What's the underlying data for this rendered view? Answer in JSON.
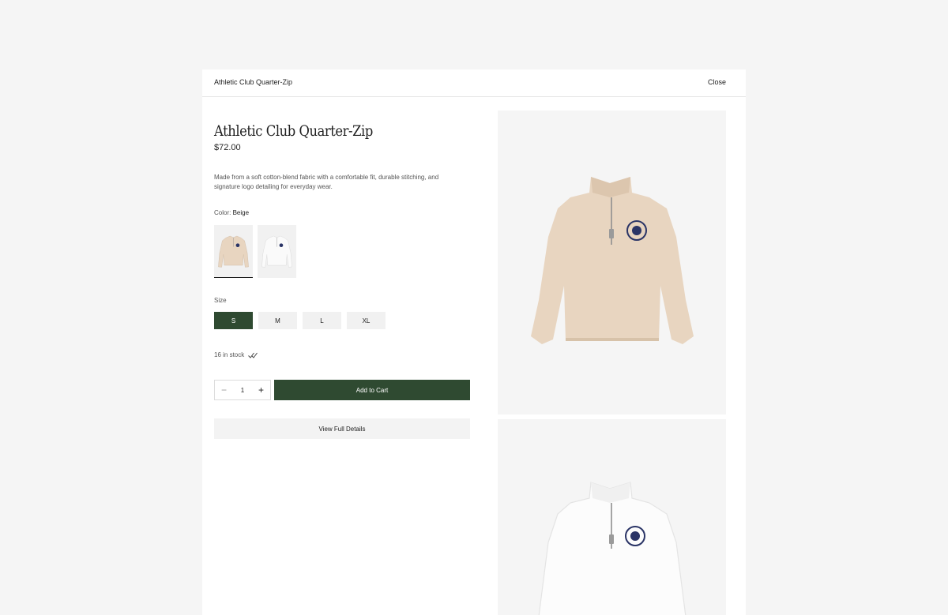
{
  "modal": {
    "header_title": "Athletic Club Quarter-Zip",
    "close_label": "Close"
  },
  "product": {
    "title": "Athletic Club Quarter-Zip",
    "price": "$72.00",
    "description": "Made from a soft cotton-blend fabric with a comfortable fit, durable stitching, and signature logo detailing for everyday wear.",
    "color_label": "Color:",
    "color_value": "Beige",
    "swatches": [
      {
        "name": "Beige",
        "color": "#e8d5c0",
        "selected": true
      },
      {
        "name": "White",
        "color": "#f7f7f7",
        "selected": false
      }
    ],
    "size_label": "Size",
    "sizes": [
      "S",
      "M",
      "L",
      "XL"
    ],
    "selected_size": "S",
    "stock_text": "16 in stock",
    "quantity": "1",
    "add_to_cart_label": "Add to Cart",
    "view_details_label": "View Full Details"
  },
  "colors": {
    "accent": "#2f4a31",
    "beige": "#e8d5c0",
    "logo_navy": "#2a3466",
    "page_bg": "#f5f5f5"
  }
}
